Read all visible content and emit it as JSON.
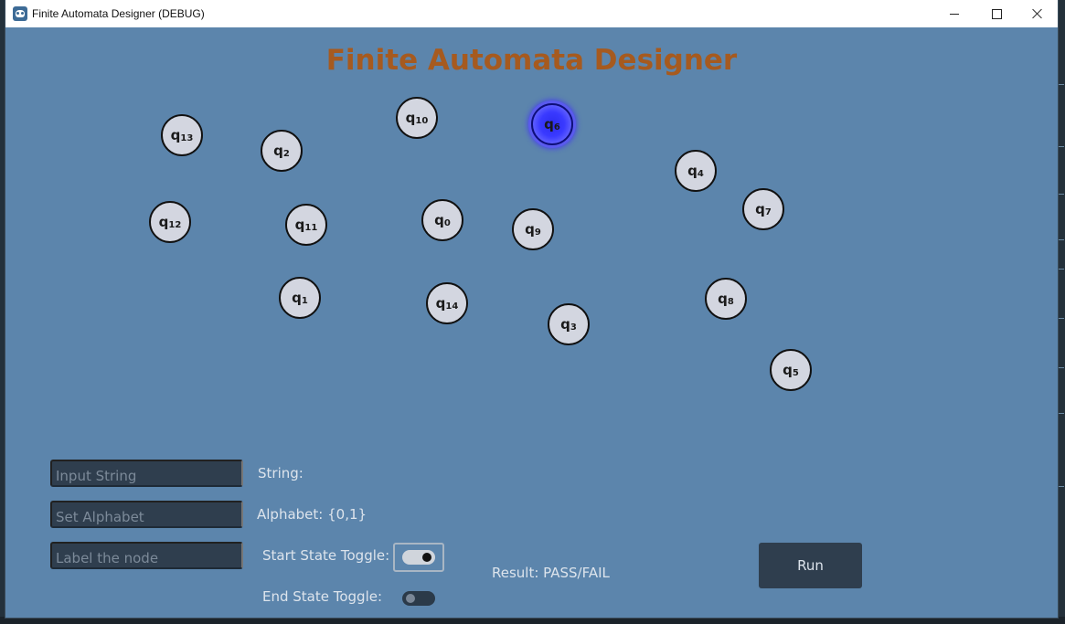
{
  "window": {
    "title": "Finite Automata Designer (DEBUG)"
  },
  "app": {
    "title": "Finite Automata Designer"
  },
  "nodes": [
    {
      "name": "q",
      "sub": "13"
    },
    {
      "name": "q",
      "sub": "2"
    },
    {
      "name": "q",
      "sub": "10"
    },
    {
      "name": "q",
      "sub": "6",
      "selected": true
    },
    {
      "name": "q",
      "sub": "4"
    },
    {
      "name": "q",
      "sub": "7"
    },
    {
      "name": "q",
      "sub": "12"
    },
    {
      "name": "q",
      "sub": "11"
    },
    {
      "name": "q",
      "sub": "0"
    },
    {
      "name": "q",
      "sub": "9"
    },
    {
      "name": "q",
      "sub": "1"
    },
    {
      "name": "q",
      "sub": "14"
    },
    {
      "name": "q",
      "sub": "3"
    },
    {
      "name": "q",
      "sub": "8"
    },
    {
      "name": "q",
      "sub": "5"
    }
  ],
  "controls": {
    "input_string_placeholder": "Input String",
    "set_alphabet_placeholder": "Set Alphabet",
    "label_node_placeholder": "Label the node",
    "string_label": "String:",
    "alphabet_label": "Alphabet: {0,1}",
    "start_state_label": "Start State Toggle:",
    "end_state_label": "End State Toggle:",
    "start_state_on": true,
    "end_state_on": false,
    "result_label": "Result: PASS/FAIL",
    "run_label": "Run"
  },
  "colors": {
    "background": "#5c85ac",
    "title": "#a65a1f",
    "node_fill": "#d3d6e0",
    "node_selected": "#3a3aff",
    "control_bg": "#2f3e4e"
  }
}
